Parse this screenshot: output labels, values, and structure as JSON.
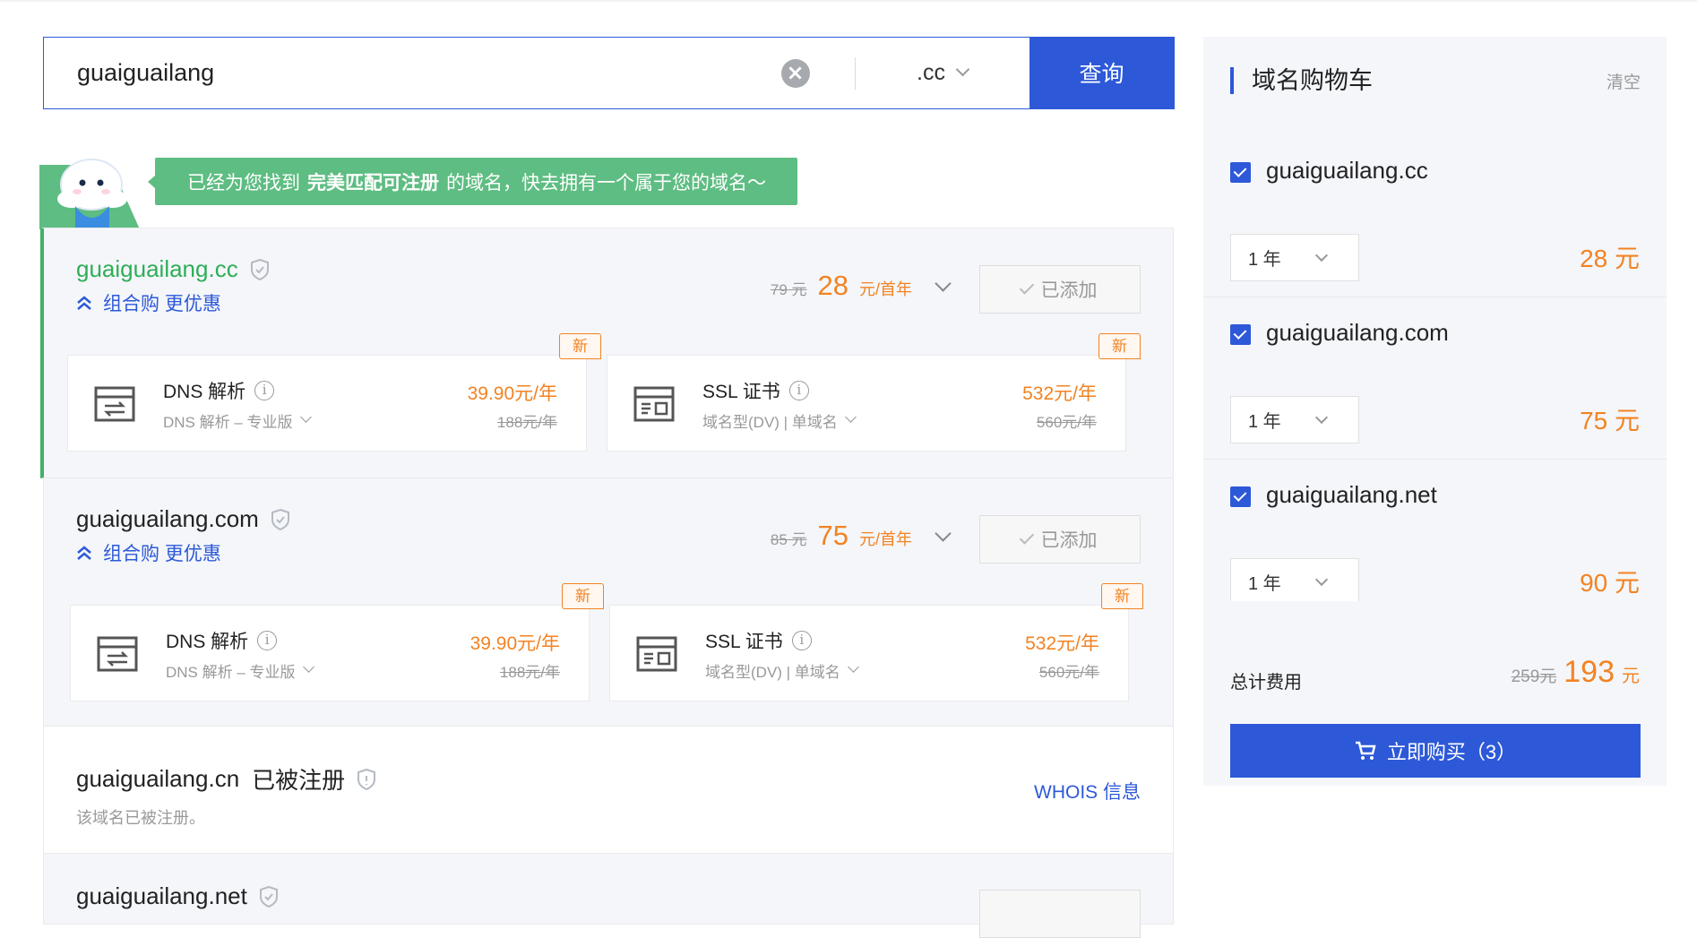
{
  "search": {
    "query": "guaiguailang",
    "tld": ".cc",
    "button_label": "查询"
  },
  "tip": {
    "prefix": "已经为您找到",
    "highlight": "完美匹配可注册",
    "suffix": "的域名，快去拥有一个属于您的域名～"
  },
  "results": [
    {
      "domain": "guaiguailang.cc",
      "combo_label": "组合购 更优惠",
      "old_price": "79 元",
      "price": "28",
      "per": "元/首年",
      "added_label": "已添加",
      "addons": [
        {
          "tag": "新",
          "title": "DNS 解析",
          "sub": "DNS 解析 – 专业版",
          "price": "39.90元/年",
          "old": "188元/年"
        },
        {
          "tag": "新",
          "title": "SSL 证书",
          "sub": "域名型(DV) | 单域名",
          "price": "532元/年",
          "old": "560元/年"
        }
      ]
    },
    {
      "domain": "guaiguailang.com",
      "combo_label": "组合购 更优惠",
      "old_price": "85 元",
      "price": "75",
      "per": "元/首年",
      "added_label": "已添加",
      "addons": [
        {
          "tag": "新",
          "title": "DNS 解析",
          "sub": "DNS 解析 – 专业版",
          "price": "39.90元/年",
          "old": "188元/年"
        },
        {
          "tag": "新",
          "title": "SSL 证书",
          "sub": "域名型(DV) | 单域名",
          "price": "532元/年",
          "old": "560元/年"
        }
      ]
    },
    {
      "domain": "guaiguailang.cn",
      "status": "已被注册",
      "note": "该域名已被注册。",
      "whois_label": "WHOIS 信息"
    },
    {
      "domain": "guaiguailang.net"
    }
  ],
  "cart": {
    "title": "域名购物车",
    "clear_label": "清空",
    "items": [
      {
        "name": "guaiguailang.cc",
        "years": "1 年",
        "price": "28 元"
      },
      {
        "name": "guaiguailang.com",
        "years": "1 年",
        "price": "75 元"
      },
      {
        "name": "guaiguailang.net",
        "years": "1 年",
        "price": "90 元"
      }
    ],
    "total_label": "总计费用",
    "total_old": "259元",
    "total": "193",
    "total_unit": "元",
    "buy_label": "立即购买（3）"
  },
  "colors": {
    "primary": "#2d59d8",
    "accent_orange": "#f28322",
    "success_green": "#5ebd82"
  }
}
